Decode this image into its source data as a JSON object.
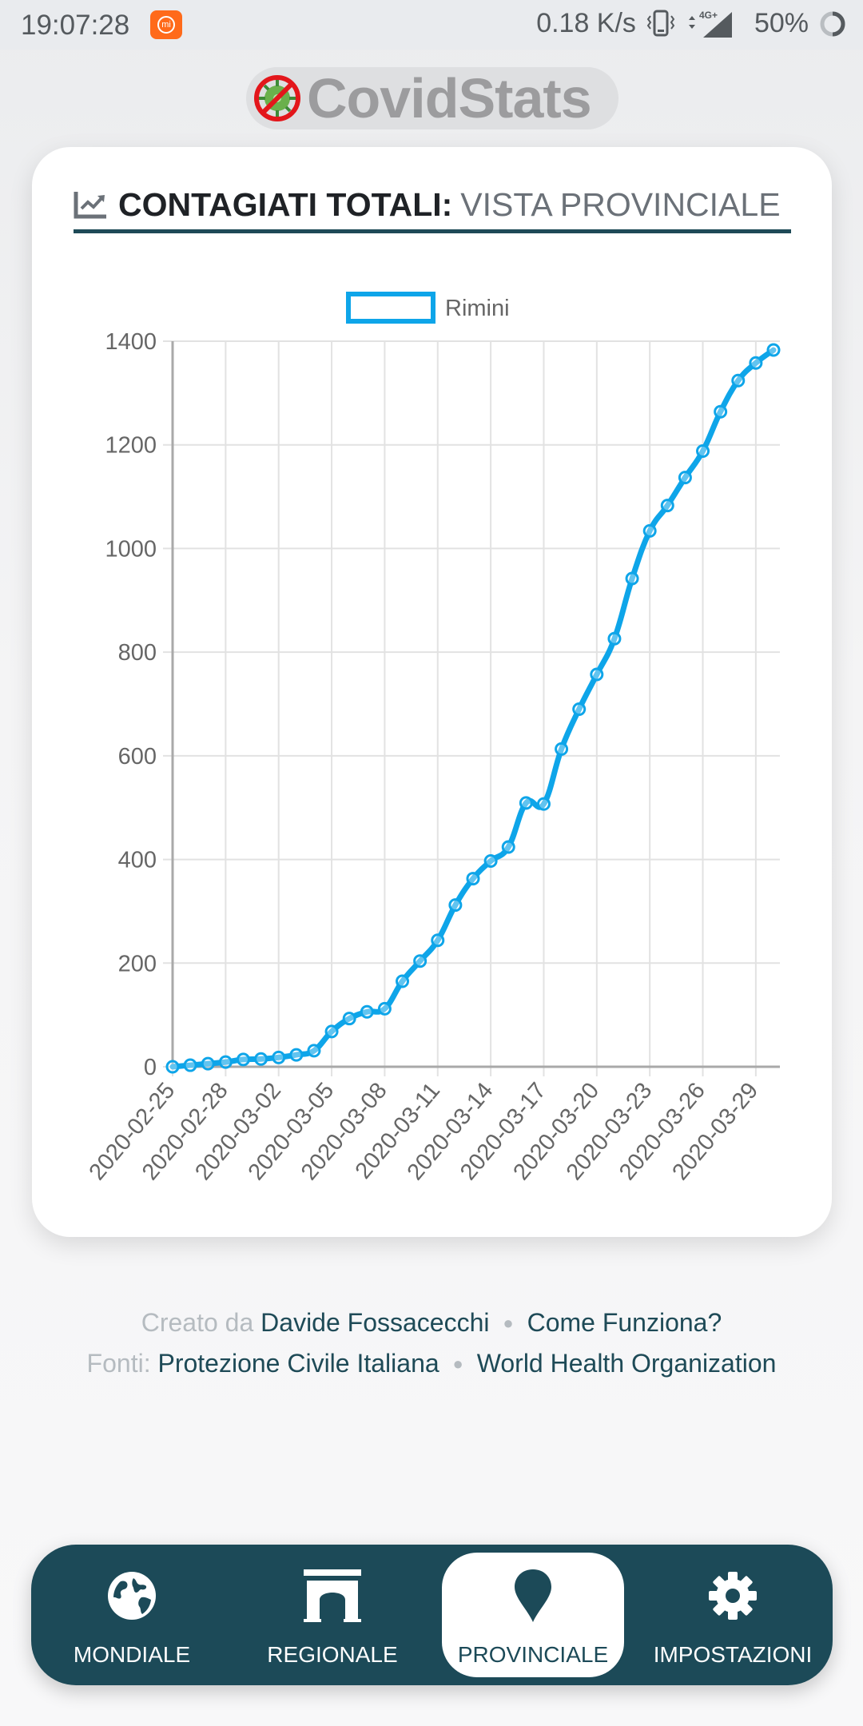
{
  "status_bar": {
    "time": "19:07:28",
    "notification_icon": "mi-app-icon",
    "network_speed": "0.18 K/s",
    "vibrate_icon": "vibrate-icon",
    "network_type": "4G+",
    "signal_icon": "signal-icon",
    "battery_percent": "50%",
    "battery_icon": "battery-ring-icon"
  },
  "app": {
    "logo_icon": "no-virus-icon",
    "title": "CovidStats"
  },
  "card": {
    "icon": "line-chart-icon",
    "title_main": "CONTAGIATI TOTALI:",
    "title_sub": "VISTA PROVINCIALE"
  },
  "chart_data": {
    "type": "line",
    "title": "",
    "xlabel": "",
    "ylabel": "",
    "legend": {
      "position": "top",
      "entries": [
        "Rimini"
      ]
    },
    "grid": true,
    "ylim": [
      0,
      1400
    ],
    "y_ticks": [
      "0",
      "200",
      "400",
      "600",
      "800",
      "1000",
      "1200",
      "1400"
    ],
    "x_tick_labels": [
      "2020-02-25",
      "2020-02-28",
      "2020-03-02",
      "2020-03-05",
      "2020-03-08",
      "2020-03-11",
      "2020-03-14",
      "2020-03-17",
      "2020-03-20",
      "2020-03-23",
      "2020-03-26",
      "2020-03-29"
    ],
    "x": [
      "2020-02-25",
      "2020-02-26",
      "2020-02-27",
      "2020-02-28",
      "2020-02-29",
      "2020-03-01",
      "2020-03-02",
      "2020-03-03",
      "2020-03-04",
      "2020-03-05",
      "2020-03-06",
      "2020-03-07",
      "2020-03-08",
      "2020-03-09",
      "2020-03-10",
      "2020-03-11",
      "2020-03-12",
      "2020-03-13",
      "2020-03-14",
      "2020-03-15",
      "2020-03-16",
      "2020-03-17",
      "2020-03-18",
      "2020-03-19",
      "2020-03-20",
      "2020-03-21",
      "2020-03-22",
      "2020-03-23",
      "2020-03-24",
      "2020-03-25",
      "2020-03-26",
      "2020-03-27",
      "2020-03-28",
      "2020-03-29",
      "2020-03-30"
    ],
    "series": [
      {
        "name": "Rimini",
        "color": "#0ea5e9",
        "values": [
          0,
          3,
          6,
          9,
          14,
          15,
          18,
          23,
          31,
          68,
          93,
          106,
          112,
          165,
          204,
          244,
          312,
          363,
          397,
          424,
          509,
          507,
          613,
          690,
          757,
          826,
          942,
          1034,
          1083,
          1137,
          1188,
          1264,
          1324,
          1358,
          1383
        ]
      }
    ]
  },
  "footer": {
    "created_by_label": "Creato da",
    "author": "Davide Fossacecchi",
    "how_it_works": "Come Funziona?",
    "sources_label": "Fonti:",
    "source_1": "Protezione Civile Italiana",
    "source_2": "World Health Organization",
    "separator": "●"
  },
  "nav": {
    "items": [
      {
        "label": "MONDIALE",
        "icon": "globe-icon",
        "active": false
      },
      {
        "label": "REGIONALE",
        "icon": "arch-icon",
        "active": false
      },
      {
        "label": "PROVINCIALE",
        "icon": "map-pin-icon",
        "active": true
      },
      {
        "label": "IMPOSTAZIONI",
        "icon": "gear-icon",
        "active": false
      }
    ]
  },
  "colors": {
    "primary": "#1c4a58",
    "line": "#0ea5e9",
    "logo_text": "#9c9c9e"
  }
}
